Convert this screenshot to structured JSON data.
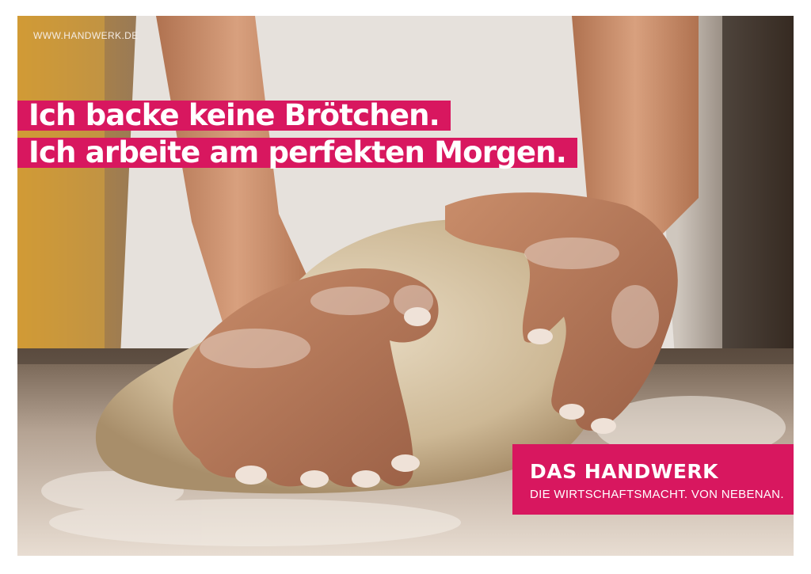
{
  "poster": {
    "url": "WWW.HANDWERK.DE",
    "headline": [
      "Ich backe keine Brötchen.",
      "Ich arbeite am perfekten Morgen."
    ],
    "brand": {
      "name": "DAS HANDWERK",
      "tagline": "DIE WIRTSCHAFTSMACHT. VON NEBENAN."
    },
    "colors": {
      "accent": "#d8175f",
      "text_on_accent": "#ffffff"
    },
    "photo_subject": "hands kneading bread dough on a floured table"
  }
}
